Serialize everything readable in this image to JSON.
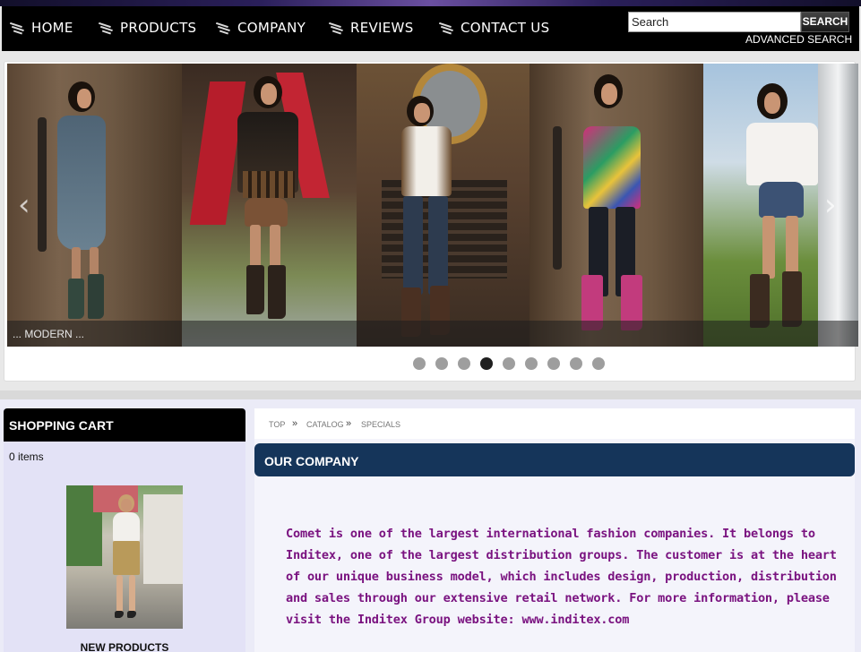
{
  "nav": {
    "items": [
      {
        "label": "HOME"
      },
      {
        "label": "PRODUCTS"
      },
      {
        "label": "COMPANY"
      },
      {
        "label": "REVIEWS"
      },
      {
        "label": "CONTACT US"
      }
    ],
    "search_placeholder": "Search",
    "search_value": "Search",
    "search_button": "SEARCH",
    "advanced_search": "ADVANCED SEARCH"
  },
  "slider": {
    "caption": "... MODERN ...",
    "prev_arrow": "‹",
    "next_arrow": "›",
    "dot_count": 9,
    "active_dot": 4
  },
  "sidebar": {
    "cart_title": "SHOPPING CART",
    "cart_items": "0 items",
    "new_products": "NEW PRODUCTS"
  },
  "breadcrumb": {
    "items": [
      "TOP",
      "CATALOG",
      "SPECIALS"
    ],
    "separator": "»"
  },
  "main": {
    "section_title": "OUR COMPANY",
    "body": "Comet is one of the largest international fashion companies. It belongs to Inditex, one of the largest distribution groups. The customer is at the heart of our unique business model, which includes design, production, distribution and sales through our extensive retail network. For more information, please visit the Inditex Group website: www.inditex.com"
  },
  "colors": {
    "nav_bg": "#000000",
    "section_head": "#15355a",
    "body_text": "#7a1380",
    "sidebar_bg": "#e3e2f6"
  }
}
